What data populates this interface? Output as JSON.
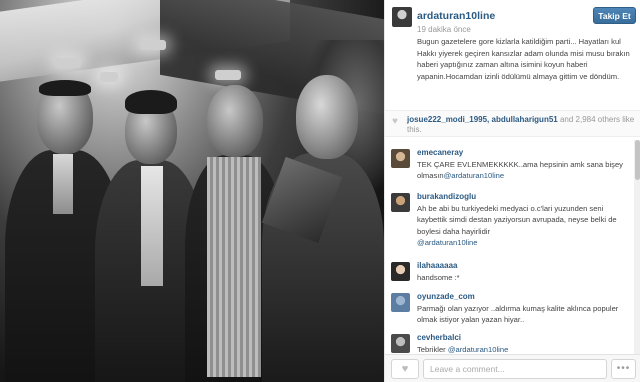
{
  "post": {
    "username": "ardaturan10line",
    "follow_label": "Takip Et",
    "time": "19 dakika önce",
    "caption": "Bugun gazetelere gore kizlarla katildiğim parti... Hayatları kul Hakkı yiyerek geçiren kansızlar adam olunda misi musu bırakın haberi yaptığınız zaman altına isimini koyun haberi yapanin.Hocamdan izinli ödülümü almaya gittim ve döndüm."
  },
  "likes": {
    "users": "josue222_modi_1995, abdullaharigun51",
    "rest": " and 2,984 others like this.",
    "icon": "heart-icon"
  },
  "comments": [
    {
      "user": "emecaneray",
      "text": "TEK ÇARE EVLENMEKKKKK..ama hepsinin amk sana bişey olmasın",
      "mention": "@ardaturan10line"
    },
    {
      "user": "burakandizoglu",
      "text": "Ah be abi bu turkiyedeki medyaci o.c'lari yuzunden seni kaybettik simdi destan yaziyorsun avrupada, neyse belki de boylesi daha hayirlidir",
      "mention": "@ardaturan10line"
    },
    {
      "user": "ilahaaaaaa",
      "text": "handsome :*",
      "mention": ""
    },
    {
      "user": "oyunzade_com",
      "text": "Parmağı olan yazıyor ..aldırma kumaş kalite aklınca populer olmak istiyor yalan yazan hiyar..",
      "mention": ""
    },
    {
      "user": "cevherbalci",
      "text": "Tebrikler ",
      "mention": "@ardaturan10line"
    }
  ],
  "footer": {
    "like_icon": "heart-icon",
    "comment_placeholder": "Leave a comment...",
    "more_label": "•••"
  },
  "colors": {
    "link": "#2b5a83",
    "follow_button": "#3a6d9a"
  }
}
